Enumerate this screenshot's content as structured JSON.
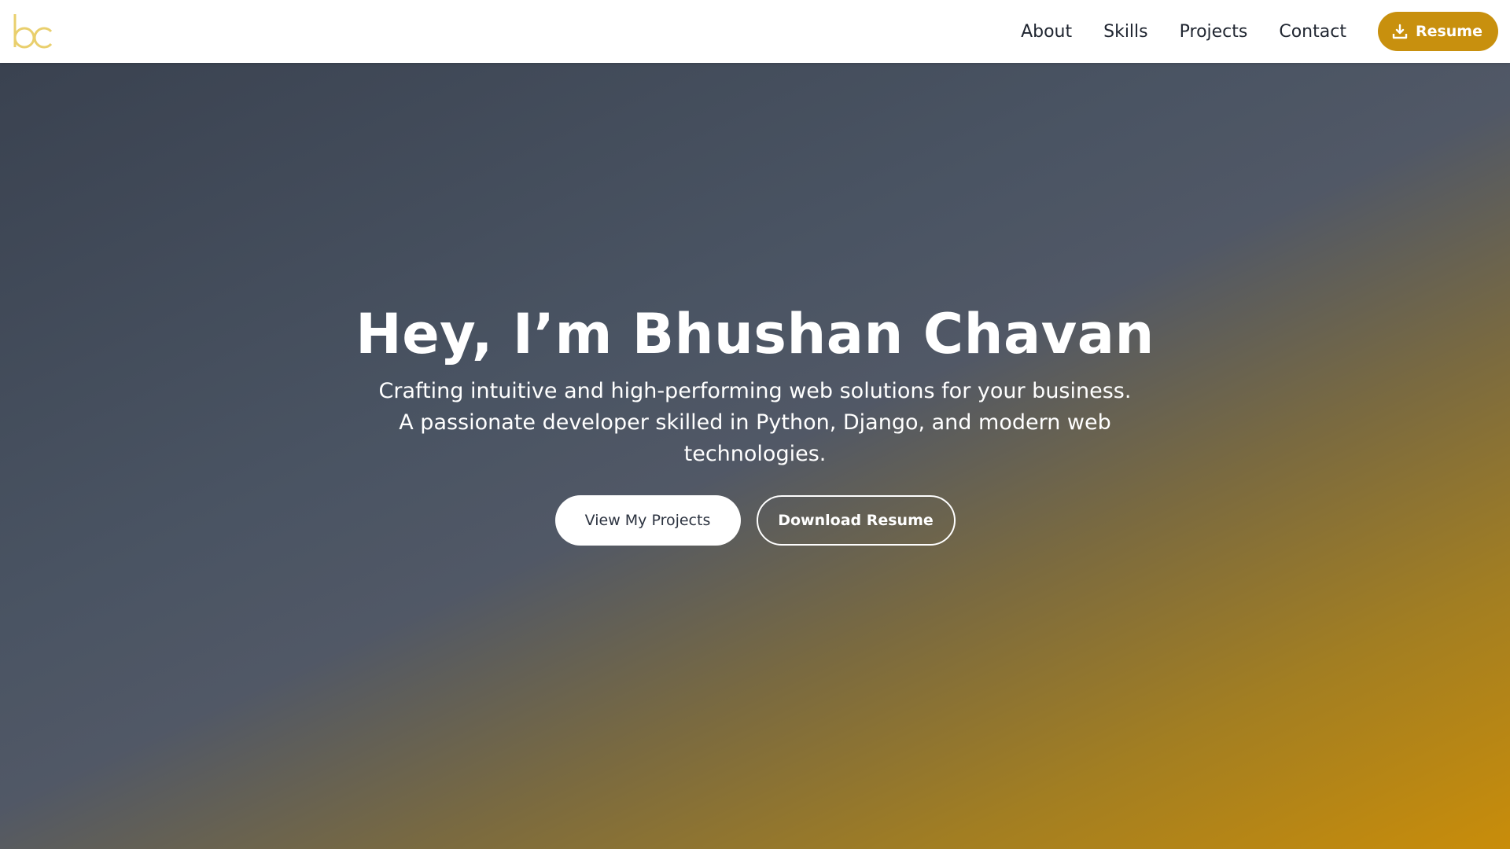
{
  "header": {
    "logo_icon": "bc-monogram-logo",
    "nav": [
      {
        "label": "About"
      },
      {
        "label": "Skills"
      },
      {
        "label": "Projects"
      },
      {
        "label": "Contact"
      }
    ],
    "resume_button": {
      "label": "Resume",
      "icon": "download-icon"
    }
  },
  "hero": {
    "title": "Hey, I’m Bhushan Chavan",
    "subtitle": "Crafting intuitive and high-performing web solutions for your business. A passionate developer skilled in Python, Django, and modern web technologies.",
    "primary_button": "View My Projects",
    "secondary_button": "Download Resume"
  },
  "colors": {
    "accent": "#c8900e",
    "gradient_start": "#3a4250",
    "gradient_end": "#c98d0a",
    "header_bg": "#ffffff"
  }
}
